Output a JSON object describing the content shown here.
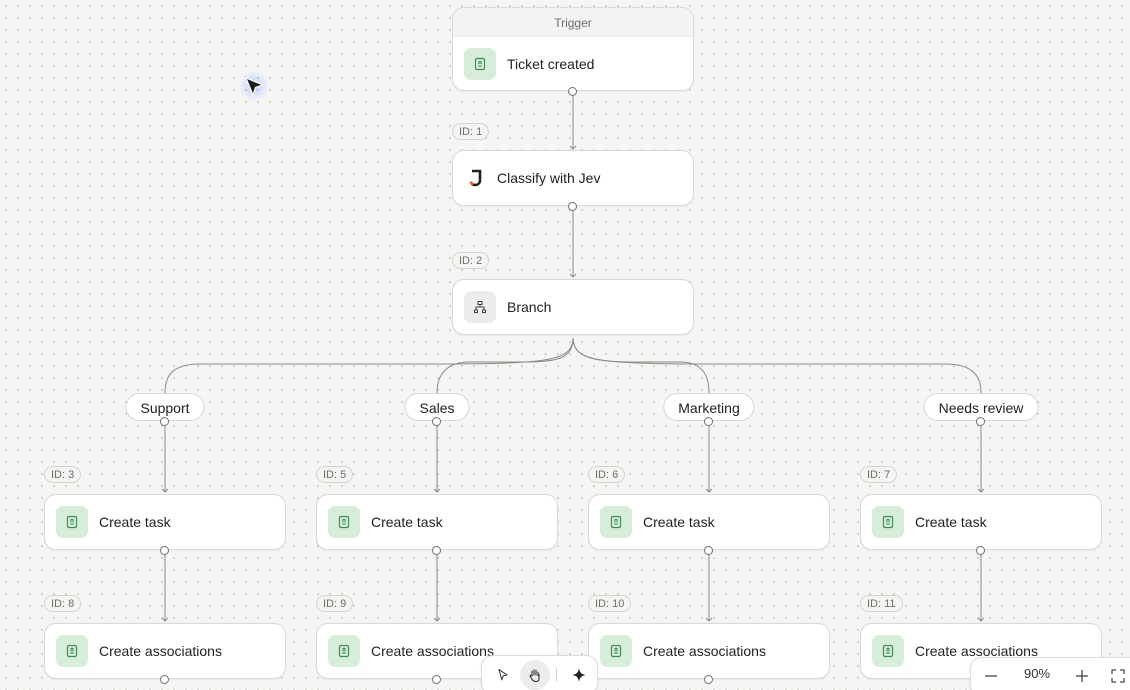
{
  "trigger": {
    "header": "Trigger",
    "label": "Ticket created",
    "icon": "ticket-icon"
  },
  "steps": [
    {
      "id": "ID: 1",
      "label": "Classify with Jev",
      "icon": "jev-logo-icon"
    },
    {
      "id": "ID: 2",
      "label": "Branch",
      "icon": "branch-icon"
    }
  ],
  "branches": [
    {
      "label": "Support",
      "tasks": [
        {
          "id": "ID: 3",
          "label": "Create task"
        },
        {
          "id": "ID: 8",
          "label": "Create associations"
        }
      ]
    },
    {
      "label": "Sales",
      "tasks": [
        {
          "id": "ID: 5",
          "label": "Create task"
        },
        {
          "id": "ID: 9",
          "label": "Create associations"
        }
      ]
    },
    {
      "label": "Marketing",
      "tasks": [
        {
          "id": "ID: 6",
          "label": "Create task"
        },
        {
          "id": "ID: 10",
          "label": "Create associations"
        }
      ]
    },
    {
      "label": "Needs review",
      "tasks": [
        {
          "id": "ID: 7",
          "label": "Create task"
        },
        {
          "id": "ID: 11",
          "label": "Create associations"
        }
      ]
    }
  ],
  "toolbar": {
    "tools": [
      "pointer-icon",
      "hand-icon",
      "sparkle-icon"
    ],
    "active_tool": "hand-icon"
  },
  "zoom": {
    "level": "90%",
    "zoom_out_icon": "minus-icon",
    "zoom_in_icon": "plus-icon",
    "fit_icon": "fit-screen-icon"
  },
  "colors": {
    "canvas": "#f5f5f4",
    "edge": "#8a8a87",
    "icon_green_bg": "#d7ecd9",
    "icon_green_fg": "#3f8f55",
    "jev_orange": "#e8632a"
  }
}
